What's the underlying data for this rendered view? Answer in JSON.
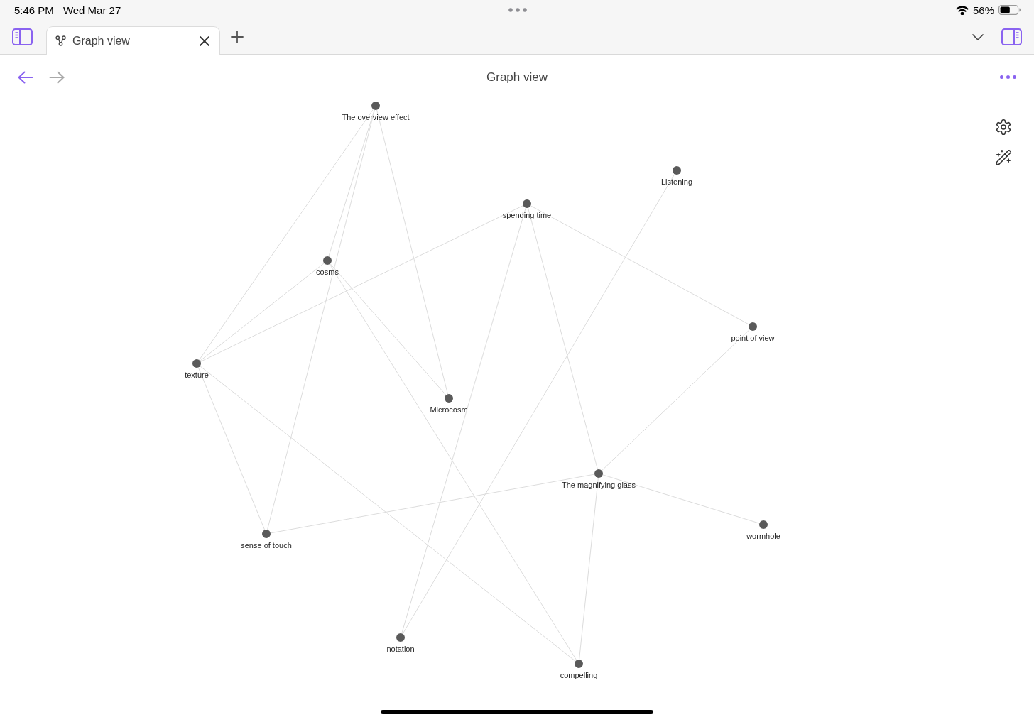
{
  "status_bar": {
    "time": "5:46 PM",
    "date": "Wed Mar 27",
    "battery": "56%"
  },
  "tabs": [
    {
      "label": "Graph view",
      "selected": true
    }
  ],
  "header": {
    "title": "Graph view",
    "back": {
      "disabled": false
    },
    "forward": {
      "disabled": true
    }
  },
  "graph": {
    "nodes": [
      {
        "label": "The overview effect"
      },
      {
        "label": "Listening"
      },
      {
        "label": "spending time"
      },
      {
        "label": "cosms"
      },
      {
        "label": "point of view"
      },
      {
        "label": "texture"
      },
      {
        "label": "Microcosm"
      },
      {
        "label": "The magnifying glass"
      },
      {
        "label": "wormhole"
      },
      {
        "label": "sense of touch"
      },
      {
        "label": "notation"
      },
      {
        "label": "compelling"
      }
    ]
  }
}
